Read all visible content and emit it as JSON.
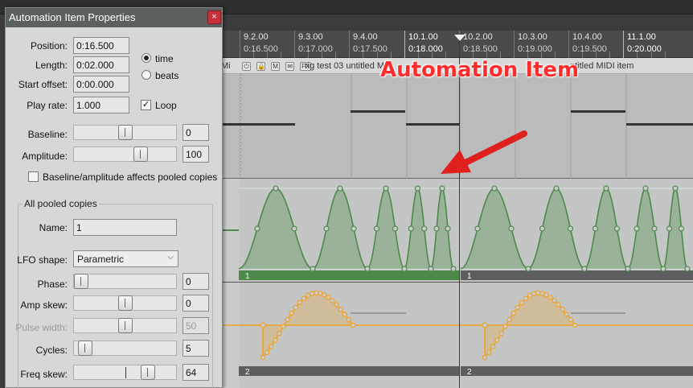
{
  "ruler": {
    "ticks": [
      {
        "bar": "9.2.00",
        "time": "0:16.500"
      },
      {
        "bar": "9.3.00",
        "time": "0:17.000"
      },
      {
        "bar": "9.4.00",
        "time": "0:17.500"
      },
      {
        "bar": "10.1.00",
        "time": "0:18.000"
      },
      {
        "bar": "10.2.00",
        "time": "0:18.500"
      },
      {
        "bar": "10.3.00",
        "time": "0:19.000"
      },
      {
        "bar": "10.4.00",
        "time": "0:19.500"
      },
      {
        "bar": "11.1.00",
        "time": "0:20.000"
      }
    ]
  },
  "item_header": {
    "left_text": "Mi",
    "button_m": "M",
    "button_fx": "FX",
    "item1_text": "rig test 03 untitled M",
    "item2_text": "ntitled MIDI item"
  },
  "envelope": {
    "item1_label": "1",
    "item2_label": "1",
    "item3_label": "2",
    "item4_label": "2",
    "green": "#4d8a4a",
    "orange": "#f0a22a"
  },
  "overlay": {
    "label": "Automation Item",
    "color": "#ff2e2e"
  },
  "dialog": {
    "title": "Automation Item Properties",
    "close_glyph": "×",
    "position_label": "Position:",
    "position_value": "0:16.500",
    "length_label": "Length:",
    "length_value": "0:02.000",
    "start_offset_label": "Start offset:",
    "start_offset_value": "0:00.000",
    "play_rate_label": "Play rate:",
    "play_rate_value": "1.000",
    "time_label": "time",
    "beats_label": "beats",
    "loop_label": "Loop",
    "loop_checked": true,
    "time_selected": true,
    "baseline_label": "Baseline:",
    "baseline_value": "0",
    "amplitude_label": "Amplitude:",
    "amplitude_value": "100",
    "pooled_check_label": "Baseline/amplitude affects pooled copies",
    "group_title": "All pooled copies",
    "name_label": "Name:",
    "name_value": "1",
    "lfo_label": "LFO shape:",
    "lfo_value": "Parametric",
    "phase_label": "Phase:",
    "phase_value": "0",
    "amp_skew_label": "Amp skew:",
    "amp_skew_value": "0",
    "pulse_width_label": "Pulse width:",
    "pulse_width_value": "50",
    "cycles_label": "Cycles:",
    "cycles_value": "5",
    "freq_skew_label": "Freq skew:",
    "freq_skew_value": "64",
    "slider_levels": {
      "baseline": 0.5,
      "amplitude": 0.68,
      "phase": 0.0,
      "amp_skew": 0.5,
      "pulse_width": 0.5,
      "cycles": 0.05,
      "freq_skew": 0.76
    }
  }
}
